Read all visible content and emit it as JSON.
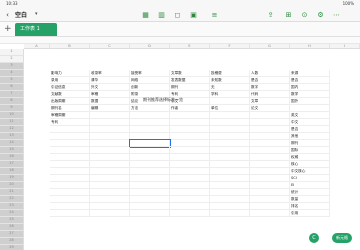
{
  "status": {
    "time": "10:33",
    "date": "1月23日周三",
    "battery": "100%"
  },
  "toolbar": {
    "title": "空白",
    "icons": [
      "table-icon",
      "grid-icon",
      "shape-icon",
      "image-icon",
      "chart-icon",
      "share-icon",
      "format-icon",
      "user-icon",
      "settings-icon",
      "more-icon"
    ]
  },
  "sheet": {
    "tab_label": "工作表 1",
    "add_label": "+"
  },
  "columns": [
    "A",
    "B",
    "C",
    "D",
    "E",
    "F",
    "G",
    "H",
    "I"
  ],
  "table": {
    "title": "期刊推荐选择标准一览",
    "headers": [
      "影响力",
      "收录率",
      "接受率",
      "文章数",
      "投稿费",
      "人数",
      "来源"
    ],
    "rows": [
      [
        "录用",
        "清华",
        "网络",
        "发表数据",
        "未知数",
        "是否",
        "是否"
      ],
      [
        "引证信息",
        "外文",
        "创新",
        "期刊",
        "无",
        "数字",
        "国内"
      ],
      [
        "文献数",
        "审稿",
        "附录",
        "专利",
        "学科",
        "代码",
        "数学"
      ],
      [
        "出版周期",
        "数据",
        "结论",
        "引文",
        "",
        "文章",
        "国外"
      ],
      [
        "期刊名",
        "编辑",
        "方法",
        "作者",
        "单位",
        "论文",
        ""
      ],
      [
        "审稿周期",
        "",
        "",
        "",
        "",
        "",
        "英文"
      ],
      [
        "专利",
        "",
        "",
        "",
        "",
        "",
        "中文"
      ],
      [
        "",
        "",
        "",
        "",
        "",
        "",
        "是否"
      ],
      [
        "",
        "",
        "",
        "",
        "",
        "",
        "其他"
      ],
      [
        "",
        "",
        "",
        "",
        "",
        "",
        "期刊"
      ],
      [
        "",
        "",
        "",
        "",
        "",
        "",
        "国际"
      ],
      [
        "",
        "",
        "",
        "",
        "",
        "",
        "权威"
      ],
      [
        "",
        "",
        "",
        "",
        "",
        "",
        "核心"
      ],
      [
        "",
        "",
        "",
        "",
        "",
        "",
        "中文核心"
      ],
      [
        "",
        "",
        "",
        "",
        "",
        "",
        "SCI"
      ],
      [
        "",
        "",
        "",
        "",
        "",
        "",
        "EI"
      ],
      [
        "",
        "",
        "",
        "",
        "",
        "",
        "统计"
      ],
      [
        "",
        "",
        "",
        "",
        "",
        "",
        "数量"
      ],
      [
        "",
        "",
        "",
        "",
        "",
        "",
        "排名"
      ],
      [
        "",
        "",
        "",
        "",
        "",
        "",
        "引用"
      ]
    ]
  },
  "fab": {
    "label": "新元格",
    "small": "C"
  }
}
